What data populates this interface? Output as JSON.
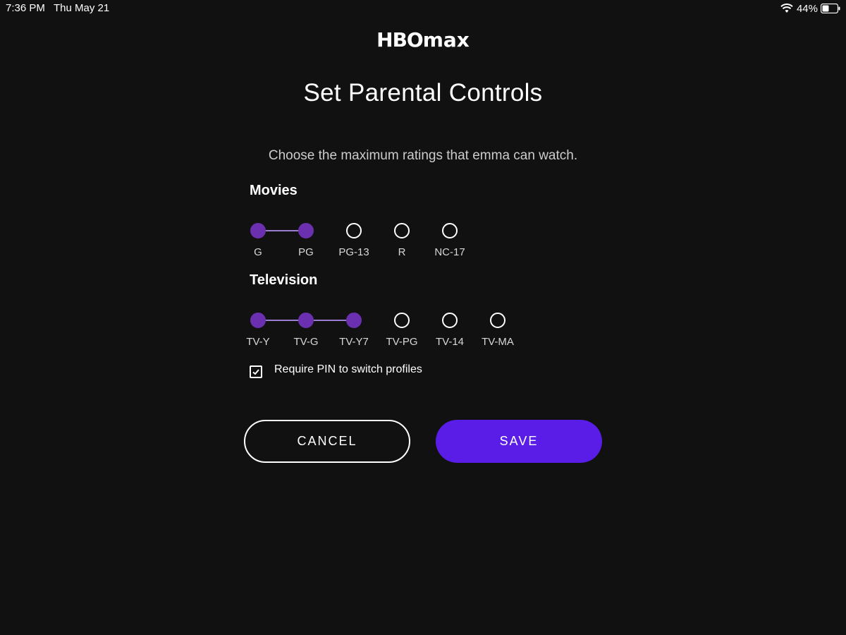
{
  "status_bar": {
    "time": "7:36 PM",
    "date": "Thu May 21",
    "battery": "44%"
  },
  "logo": {
    "text_hbo": "HBO",
    "text_max": "max"
  },
  "title": "Set Parental Controls",
  "subtitle": "Choose the maximum ratings that emma can watch.",
  "movies": {
    "heading": "Movies",
    "ratings": [
      "G",
      "PG",
      "PG-13",
      "R",
      "NC-17"
    ],
    "selected_max": "PG"
  },
  "television": {
    "heading": "Television",
    "ratings": [
      "TV-Y",
      "TV-G",
      "TV-Y7",
      "TV-PG",
      "TV-14",
      "TV-MA"
    ],
    "selected_max": "TV-Y7"
  },
  "require_pin": {
    "label": "Require PIN to switch profiles",
    "checked": true
  },
  "buttons": {
    "cancel": "CANCEL",
    "save": "SAVE"
  },
  "colors": {
    "background": "#111111",
    "accent_purple": "#6a30b0",
    "save_button": "#5a1de8"
  }
}
